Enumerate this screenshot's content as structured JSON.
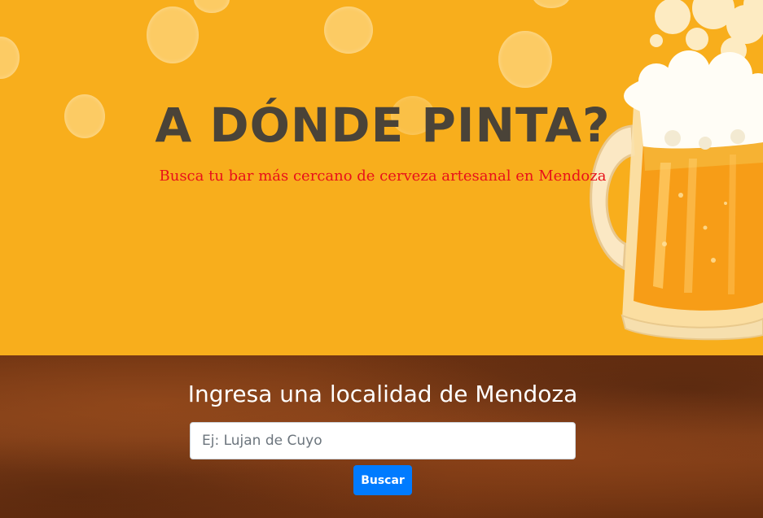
{
  "hero": {
    "title": "A DÓNDE PINTA?",
    "subtitle": "Busca tu bar más cercano de cerveza artesanal en Mendoza",
    "background_color": "#f8ae1c",
    "title_color": "#4a4338",
    "subtitle_color": "#e8101a",
    "illustration": "beer-mug-icon"
  },
  "search": {
    "heading": "Ingresa una localidad de Mendoza",
    "input_value": "",
    "input_placeholder": "Ej: Lujan de Cuyo",
    "button_label": "Buscar",
    "button_color": "#007bff"
  }
}
